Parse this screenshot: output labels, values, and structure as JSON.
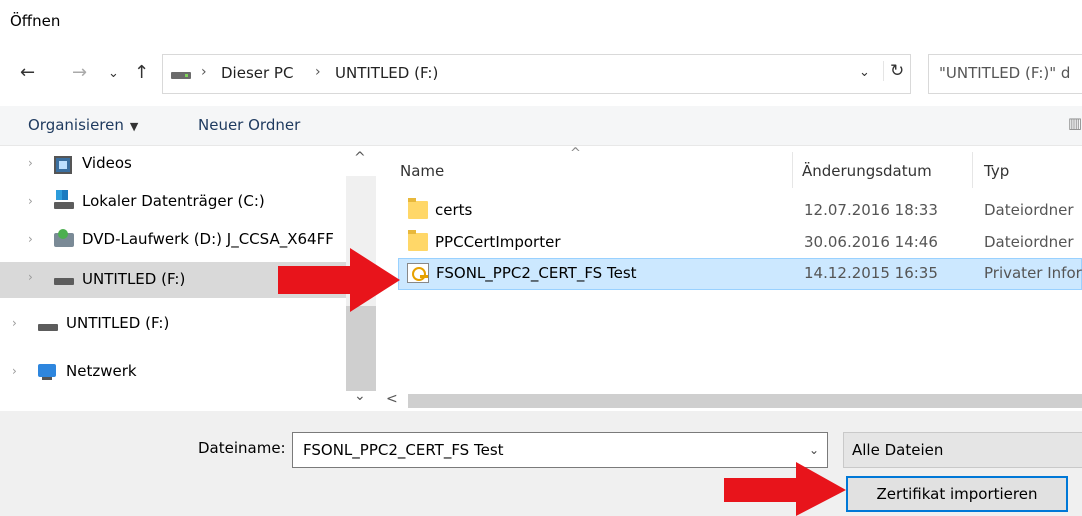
{
  "window": {
    "title": "Öffnen"
  },
  "nav": {
    "back": "←",
    "forward": "→",
    "recent": "⌄",
    "up": "↑",
    "breadcrumb": [
      "Dieser PC",
      "UNTITLED (F:)"
    ],
    "breadcrumb_sep": "›",
    "dropdown": "⌄",
    "refresh": "↻",
    "search_placeholder": "\"UNTITLED (F:)\" d"
  },
  "toolbar": {
    "organize": "Organisieren",
    "organize_caret": "▼",
    "new_folder": "Neuer Ordner",
    "view_icon": "▥"
  },
  "sidebar": {
    "items": [
      {
        "label": "Videos",
        "icon": "video-icon"
      },
      {
        "label": "Lokaler Datenträger (C:)",
        "icon": "local-disk-icon"
      },
      {
        "label": "DVD-Laufwerk (D:) J_CCSA_X64FF",
        "icon": "dvd-drive-icon"
      },
      {
        "label": "UNTITLED (F:)",
        "icon": "usb-drive-icon",
        "selected": true
      },
      {
        "label": "UNTITLED (F:)",
        "icon": "usb-drive-icon"
      },
      {
        "label": "Netzwerk",
        "icon": "network-icon"
      }
    ],
    "chevron": "›",
    "scroll_up": "^",
    "scroll_down": "⌄"
  },
  "filelist": {
    "sort_indicator": "^",
    "columns": [
      "Name",
      "Änderungsdatum",
      "Typ"
    ],
    "rows": [
      {
        "name": "certs",
        "date": "12.07.2016 18:33",
        "type": "Dateiordner",
        "icon": "folder-icon"
      },
      {
        "name": "PPCCertImporter",
        "date": "30.06.2016 14:46",
        "type": "Dateiordner",
        "icon": "folder-icon"
      },
      {
        "name": "FSONL_PPC2_CERT_FS Test",
        "date": "14.12.2015 16:35",
        "type": "Privater Infor",
        "icon": "certificate-icon",
        "selected": true
      }
    ],
    "hscroll_left": "<"
  },
  "footer": {
    "filename_label": "Dateiname:",
    "filename_value": "FSONL_PPC2_CERT_FS Test",
    "filename_dropdown": "⌄",
    "filter": "Alle Dateien",
    "import_button": "Zertifikat importieren"
  },
  "colors": {
    "arrow": "#e8141b",
    "selection": "#cce8ff",
    "button_border": "#0078d7"
  }
}
